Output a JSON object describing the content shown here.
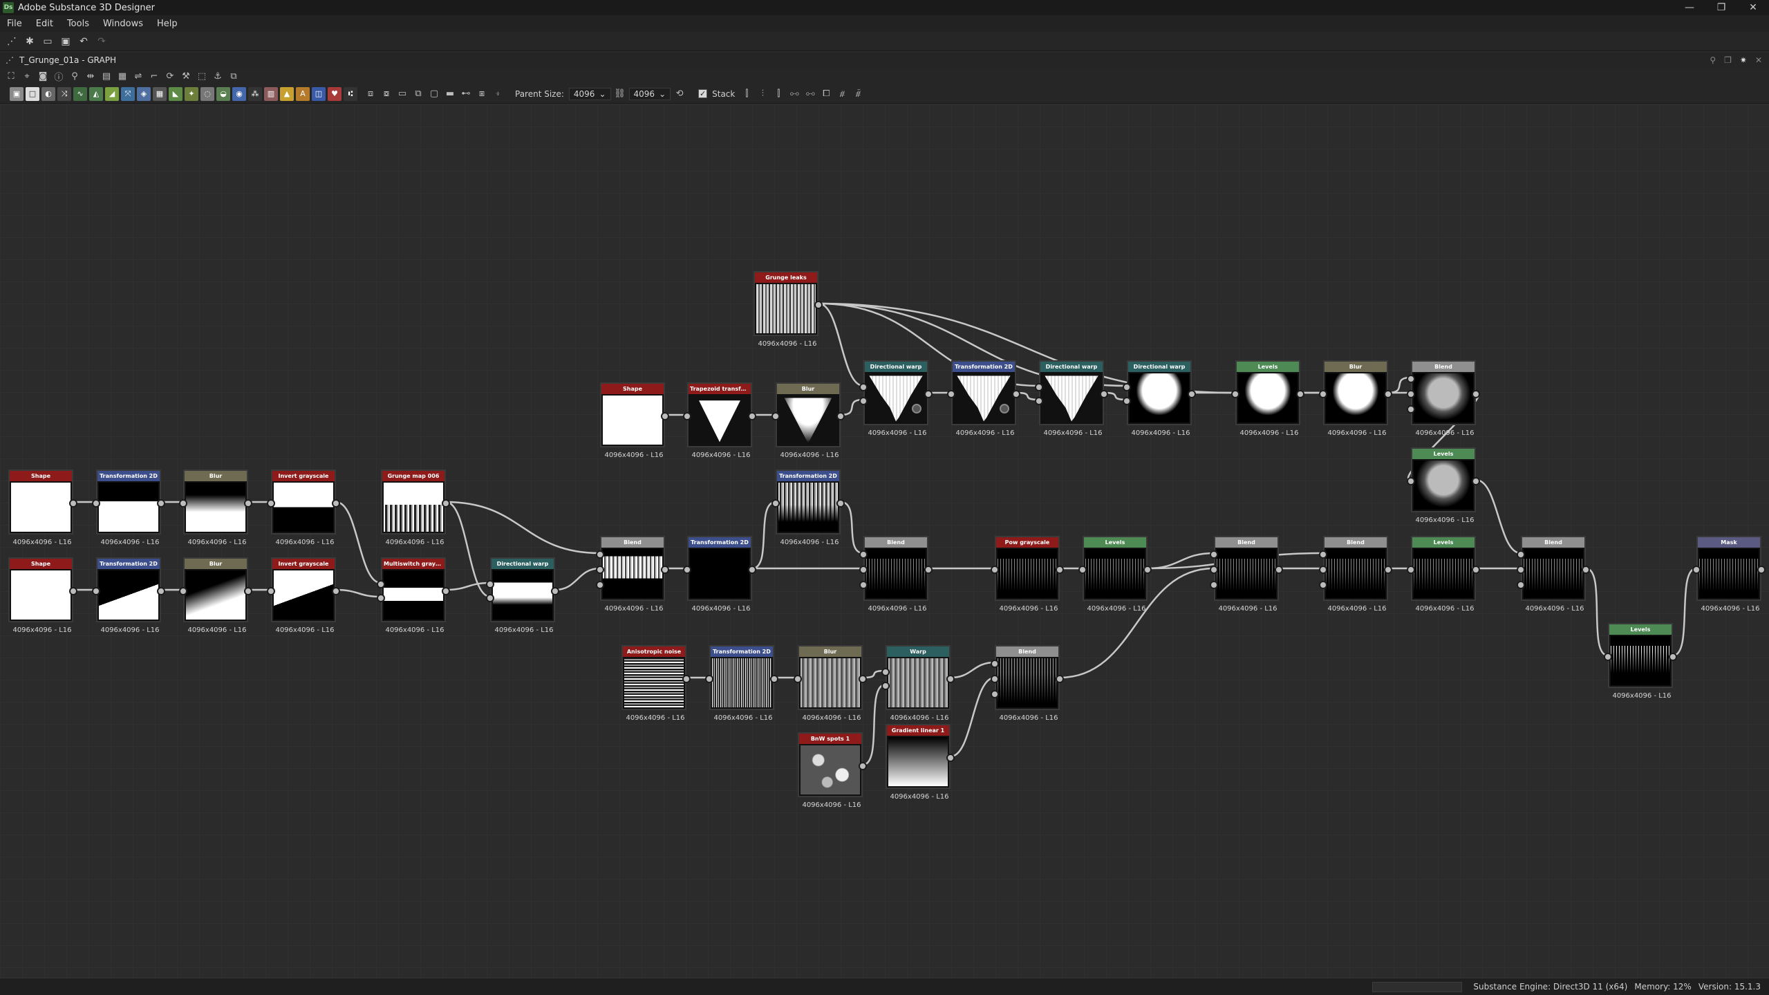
{
  "app": {
    "title": "Adobe Substance 3D Designer",
    "logo": "Ds",
    "controls": {
      "minimize": "—",
      "maximize": "❐",
      "close": "✕"
    }
  },
  "menu": [
    "File",
    "Edit",
    "Tools",
    "Windows",
    "Help"
  ],
  "graph": {
    "title": "T_Grunge_01a - GRAPH",
    "parent_size_label": "Parent Size:",
    "parent_size_value": "4096",
    "size_value": "4096",
    "stack_label": "Stack"
  },
  "status": {
    "engine": "Substance Engine: Direct3D 11 (x64)",
    "memory": "Memory: 12%",
    "version": "Version: 15.1.3"
  },
  "colors": {
    "red": "#8e1a1a",
    "blue": "#3d4e8c",
    "olive": "#6f6b52",
    "teal": "#2b5f60",
    "green": "#4d8a54",
    "gray": "#8f8f8f",
    "violet": "#5b5a83"
  },
  "nodes": [
    {
      "id": "shape1",
      "title": "Shape",
      "res": "4096x4096 - L16",
      "color": "red",
      "thumb": "t-white"
    },
    {
      "id": "trans1",
      "title": "Transformation 2D",
      "res": "4096x4096 - L16",
      "color": "blue",
      "thumb": "t-halfw"
    },
    {
      "id": "blur1",
      "title": "Blur",
      "res": "4096x4096 - L16",
      "color": "olive",
      "thumb": "t-halfblur"
    },
    {
      "id": "inv1",
      "title": "Invert grayscale",
      "res": "4096x4096 - L16",
      "color": "red",
      "thumb": "t-invhalf"
    },
    {
      "id": "grungemap",
      "title": "Grunge map 006",
      "res": "4096x4096 - L16",
      "color": "red",
      "thumb": "t-grungemap"
    },
    {
      "id": "shape2",
      "title": "Shape",
      "res": "4096x4096 - L16",
      "color": "red",
      "thumb": "t-white"
    },
    {
      "id": "trans2",
      "title": "Transformation 2D",
      "res": "4096x4096 - L16",
      "color": "blue",
      "thumb": "t-diag"
    },
    {
      "id": "blur2",
      "title": "Blur",
      "res": "4096x4096 - L16",
      "color": "olive",
      "thumb": "t-diagblur"
    },
    {
      "id": "inv2",
      "title": "Invert grayscale",
      "res": "4096x4096 - L16",
      "color": "red",
      "thumb": "t-invdiag"
    },
    {
      "id": "multi",
      "title": "Multiswitch grayscale",
      "res": "4096x4096 - L16",
      "color": "red",
      "thumb": "t-mgray"
    },
    {
      "id": "dwarp0",
      "title": "Directional warp",
      "res": "4096x4096 - L16",
      "color": "teal",
      "thumb": "t-dwarp"
    },
    {
      "id": "blend1",
      "title": "Blend",
      "res": "4096x4096 - L16",
      "color": "gray",
      "thumb": "t-blendfur"
    },
    {
      "id": "trans3",
      "title": "Transformation 2D",
      "res": "4096x4096 - L16",
      "color": "blue",
      "thumb": "t-black"
    },
    {
      "id": "trans4",
      "title": "Transformation 2D",
      "res": "4096x4096 - L16",
      "color": "blue",
      "thumb": "t-tfur"
    },
    {
      "id": "blend2",
      "title": "Blend",
      "res": "4096x4096 - L16",
      "color": "gray",
      "thumb": "t-darkfur"
    },
    {
      "id": "pow",
      "title": "Pow grayscale",
      "res": "4096x4096 - L16",
      "color": "red",
      "thumb": "t-darkfur"
    },
    {
      "id": "levels1",
      "title": "Levels",
      "res": "4096x4096 - L16",
      "color": "green",
      "thumb": "t-darkfur"
    },
    {
      "id": "blend3",
      "title": "Blend",
      "res": "4096x4096 - L16",
      "color": "gray",
      "thumb": "t-darkfur"
    },
    {
      "id": "blend4",
      "title": "Blend",
      "res": "4096x4096 - L16",
      "color": "gray",
      "thumb": "t-darkfur"
    },
    {
      "id": "levels2",
      "title": "Levels",
      "res": "4096x4096 - L16",
      "color": "green",
      "thumb": "t-darkfur"
    },
    {
      "id": "blend5",
      "title": "Blend",
      "res": "4096x4096 - L16",
      "color": "gray",
      "thumb": "t-darkfur"
    },
    {
      "id": "mask",
      "title": "Mask",
      "res": "4096x4096 - L16",
      "color": "violet",
      "thumb": "t-darkfur"
    },
    {
      "id": "levels3",
      "title": "Levels",
      "res": "4096x4096 - L16",
      "color": "green",
      "thumb": "t-levelstr"
    },
    {
      "id": "grungeleaks",
      "title": "Grunge leaks",
      "res": "4096x4096 - L16",
      "color": "red",
      "thumb": "t-grunge"
    },
    {
      "id": "shape3",
      "title": "Shape",
      "res": "4096x4096 - L16",
      "color": "red",
      "thumb": "t-white"
    },
    {
      "id": "trap",
      "title": "Trapezoid transform gra...",
      "res": "4096x4096 - L16",
      "color": "red",
      "thumb": "tri"
    },
    {
      "id": "blur3",
      "title": "Blur",
      "res": "4096x4096 - L16",
      "color": "olive",
      "thumb": "triblur"
    },
    {
      "id": "dwarp1",
      "title": "Directional warp",
      "res": "4096x4096 - L16",
      "color": "teal",
      "thumb": "trifur"
    },
    {
      "id": "trans5",
      "title": "Transformation 2D",
      "res": "4096x4096 - L16",
      "color": "blue",
      "thumb": "trifur"
    },
    {
      "id": "dwarp2",
      "title": "Directional warp",
      "res": "4096x4096 - L16",
      "color": "teal",
      "thumb": "trifur"
    },
    {
      "id": "dwarp3",
      "title": "Directional warp",
      "res": "4096x4096 - L16",
      "color": "teal",
      "thumb": "t-blob"
    },
    {
      "id": "levels4",
      "title": "Levels",
      "res": "4096x4096 - L16",
      "color": "green",
      "thumb": "t-blob"
    },
    {
      "id": "blur4",
      "title": "Blur",
      "res": "4096x4096 - L16",
      "color": "olive",
      "thumb": "t-blob"
    },
    {
      "id": "blend6",
      "title": "Blend",
      "res": "4096x4096 - L16",
      "color": "gray",
      "thumb": "t-blobgray"
    },
    {
      "id": "levels5",
      "title": "Levels",
      "res": "4096x4096 - L16",
      "color": "green",
      "thumb": "t-blobgray"
    },
    {
      "id": "aniso",
      "title": "Anisotropic noise",
      "res": "4096x4096 - L16",
      "color": "red",
      "thumb": "t-wave"
    },
    {
      "id": "trans6",
      "title": "Transformation 2D",
      "res": "4096x4096 - L16",
      "color": "blue",
      "thumb": "t-vlines"
    },
    {
      "id": "blur5",
      "title": "Blur",
      "res": "4096x4096 - L16",
      "color": "olive",
      "thumb": "t-vblur"
    },
    {
      "id": "warp",
      "title": "Warp",
      "res": "4096x4096 - L16",
      "color": "teal",
      "thumb": "t-vblur"
    },
    {
      "id": "blend7",
      "title": "Blend",
      "res": "4096x4096 - L16",
      "color": "gray",
      "thumb": "t-vdark"
    },
    {
      "id": "bnw",
      "title": "BnW spots 1",
      "res": "4096x4096 - L16",
      "color": "red",
      "thumb": "t-spots"
    },
    {
      "id": "gradlin",
      "title": "Gradient linear 1",
      "res": "4096x4096 - L16",
      "color": "red",
      "thumb": "t-gradlin"
    }
  ]
}
